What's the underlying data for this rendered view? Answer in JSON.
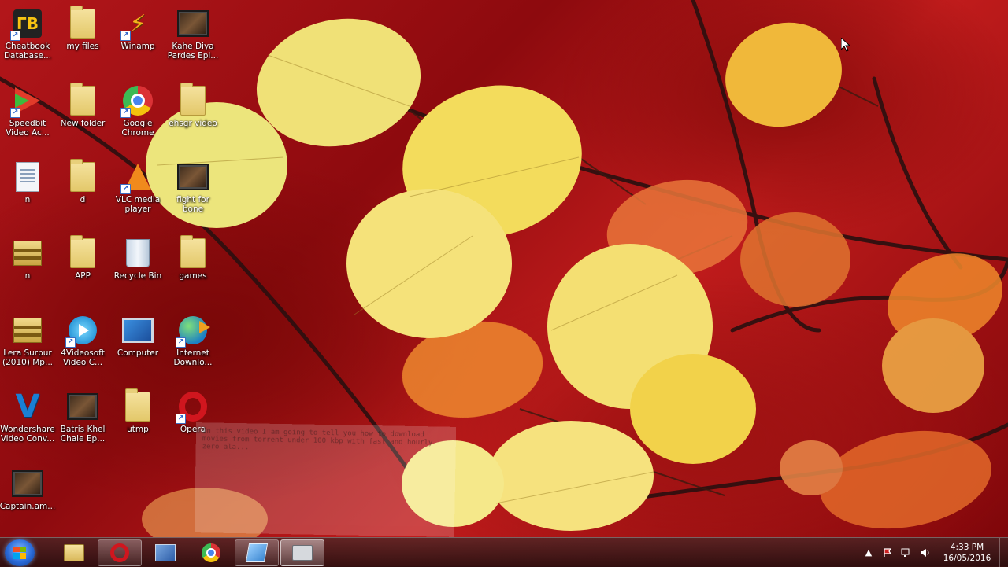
{
  "desktop": {
    "icons": [
      {
        "label": "Cheatbook\nDatabase...",
        "icon": "cheatbook-icon"
      },
      {
        "label": "my files",
        "icon": "folder-icon"
      },
      {
        "label": "Winamp",
        "icon": "winamp-icon"
      },
      {
        "label": "Kahe Diya\nPardes   Epi...",
        "icon": "video-thumbnail-icon"
      },
      {
        "label": "Speedbit\nVideo Ac...",
        "icon": "speedbit-icon"
      },
      {
        "label": "New folder",
        "icon": "folder-icon"
      },
      {
        "label": "Google\nChrome",
        "icon": "chrome-icon"
      },
      {
        "label": "ehsgr video",
        "icon": "folder-icon"
      },
      {
        "label": "n",
        "icon": "document-icon"
      },
      {
        "label": "d",
        "icon": "folder-3d-icon"
      },
      {
        "label": "VLC media\nplayer",
        "icon": "vlc-icon"
      },
      {
        "label": "fight for\nbone",
        "icon": "video-thumbnail-icon"
      },
      {
        "label": "n",
        "icon": "archive-icon"
      },
      {
        "label": "APP",
        "icon": "folder-icon"
      },
      {
        "label": "Recycle Bin",
        "icon": "recycle-bin-icon"
      },
      {
        "label": "games",
        "icon": "folder-icon"
      },
      {
        "label": "Lera Surpur\n(2010) Mp...",
        "icon": "archive-icon"
      },
      {
        "label": "4Videosoft\nVideo C...",
        "icon": "4videosoft-icon"
      },
      {
        "label": "Computer",
        "icon": "computer-icon"
      },
      {
        "label": "Internet\nDownlo...",
        "icon": "idm-icon"
      },
      {
        "label": "Wondershare\nVideo Conv...",
        "icon": "wondershare-icon"
      },
      {
        "label": "Batris Khel\nChale   Ep...",
        "icon": "video-thumbnail-icon"
      },
      {
        "label": "utmp",
        "icon": "folder-icon"
      },
      {
        "label": "Opera",
        "icon": "opera-icon"
      },
      {
        "label": "Captain.am...",
        "icon": "video-thumbnail-icon"
      }
    ],
    "overlay_note": "In this video I am going to tell you how to download movies from torrent under 100 kbp with fast and hourly zero ala..."
  },
  "taskbar": {
    "start_label": "Start",
    "buttons": [
      {
        "name": "explorer",
        "icon": "folder-icon"
      },
      {
        "name": "opera",
        "icon": "opera-icon"
      },
      {
        "name": "network",
        "icon": "network-icon"
      },
      {
        "name": "chrome",
        "icon": "chrome-icon"
      },
      {
        "name": "app",
        "icon": "generic-app-icon"
      },
      {
        "name": "screen-recorder",
        "icon": "camera-icon"
      }
    ],
    "tray": {
      "show_hidden": "▲",
      "clock_time": "4:33 PM",
      "clock_date": "16/05/2016"
    }
  },
  "colors": {
    "wallpaper_red": "#b3161a",
    "leaf_yellow": "#f2e07a",
    "leaf_orange": "#f08a2c"
  }
}
